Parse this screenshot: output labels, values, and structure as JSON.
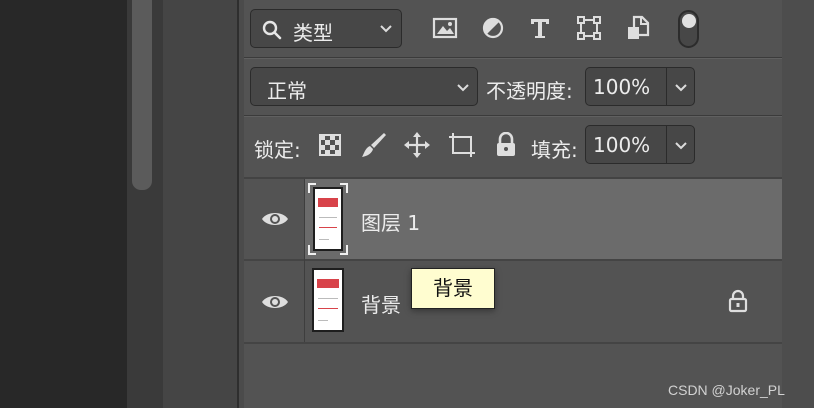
{
  "filter": {
    "kind_label": "类型"
  },
  "blend": {
    "mode": "正常",
    "opacity_label": "不透明度:",
    "opacity_value": "100%"
  },
  "lock": {
    "label": "锁定:",
    "fill_label": "填充:",
    "fill_value": "100%"
  },
  "layers": [
    {
      "name": "图层 1"
    },
    {
      "name": "背景"
    }
  ],
  "tooltip": "背景",
  "watermark": "CSDN @Joker_PL"
}
